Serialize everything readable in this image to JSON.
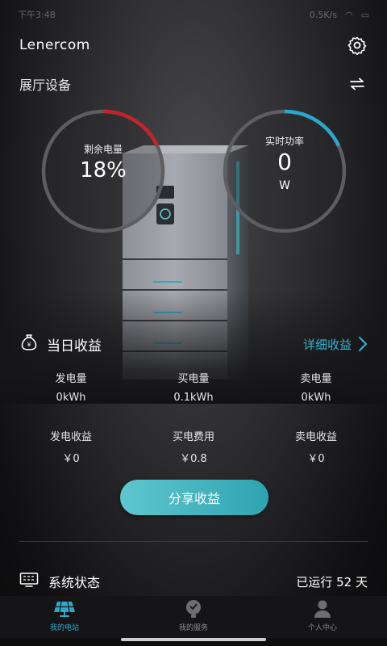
{
  "status_bar": {
    "left_text": "下午3:48",
    "right_text": "0.5K/s"
  },
  "header": {
    "brand": "Lenercom"
  },
  "device": {
    "title": "展厅设备"
  },
  "gauges": {
    "soc": {
      "label": "剩余电量",
      "value": "18%",
      "fraction": 0.18,
      "color": "#c4232b"
    },
    "power": {
      "label": "实时功率",
      "value": "0",
      "unit": "W",
      "fraction": 0.18,
      "color": "#27a9cf"
    }
  },
  "income": {
    "title": "当日收益",
    "detail_link": "详细收益",
    "items": [
      {
        "label": "发电量",
        "value": "0kWh"
      },
      {
        "label": "买电量",
        "value": "0.1kWh"
      },
      {
        "label": "卖电量",
        "value": "0kWh"
      },
      {
        "label": "发电收益",
        "value": "￥0"
      },
      {
        "label": "买电费用",
        "value": "￥0.8"
      },
      {
        "label": "卖电收益",
        "value": "￥0"
      }
    ],
    "share_button": "分享收益"
  },
  "system": {
    "title": "系统状态",
    "running": "已运行 52 天"
  },
  "tabbar": {
    "tabs": [
      {
        "label": "我的电站",
        "active": true
      },
      {
        "label": "我的服务",
        "active": false
      },
      {
        "label": "个人中心",
        "active": false
      }
    ]
  },
  "colors": {
    "accent": "#2fb7d6",
    "button": "#45b6c2",
    "soc_arc": "#c4232b",
    "power_arc": "#27a9cf"
  }
}
